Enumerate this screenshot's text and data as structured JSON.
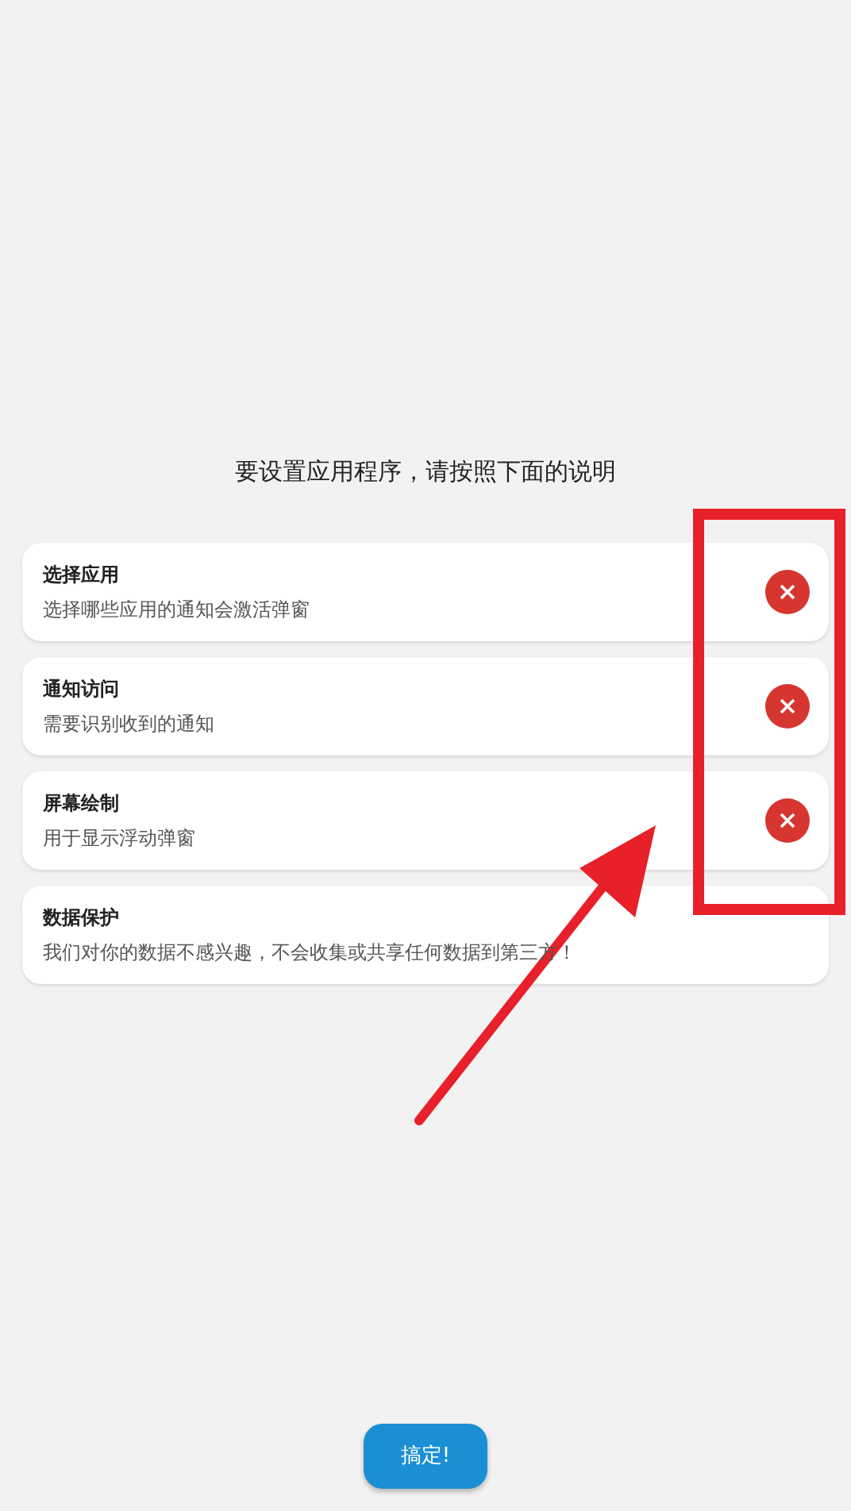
{
  "heading": "要设置应用程序，请按照下面的说明",
  "steps": [
    {
      "kind": "permission",
      "title": "选择应用",
      "description": "选择哪些应用的通知会激活弹窗",
      "granted": false
    },
    {
      "kind": "permission",
      "title": "通知访问",
      "description": "需要识别收到的通知",
      "granted": false
    },
    {
      "kind": "permission",
      "title": "屏幕绘制",
      "description": "用于显示浮动弹窗",
      "granted": false
    },
    {
      "kind": "info",
      "title": "数据保护",
      "description": "我们对你的数据不感兴趣，不会收集或共享任何数据到第三方！"
    }
  ],
  "done_button": "搞定!"
}
